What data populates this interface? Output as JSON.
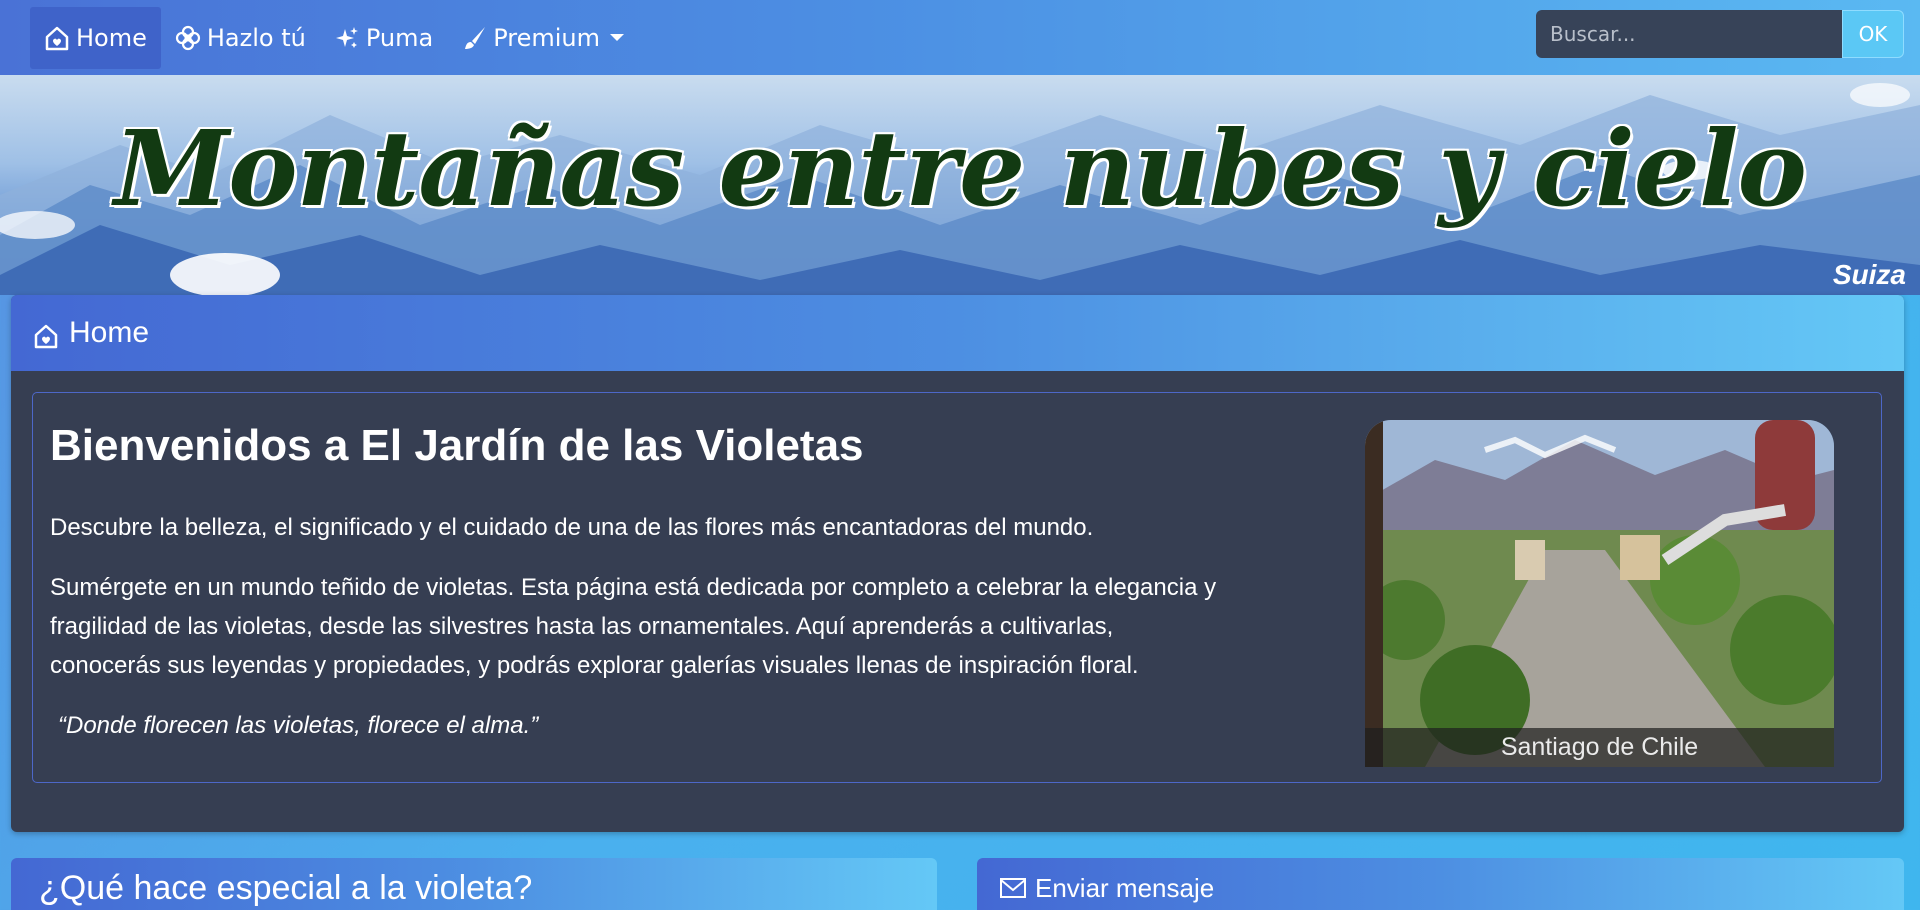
{
  "nav": {
    "items": [
      {
        "label": "Home",
        "icon": "house-heart-icon",
        "active": true
      },
      {
        "label": "Hazlo tú",
        "icon": "flower-icon",
        "active": false
      },
      {
        "label": "Puma",
        "icon": "sparkles-icon",
        "active": false
      },
      {
        "label": "Premium",
        "icon": "brush-icon",
        "active": false,
        "dropdown": true
      }
    ],
    "search": {
      "placeholder": "Buscar...",
      "button_label": "OK"
    }
  },
  "banner": {
    "title": "Montañas entre nubes y cielo",
    "caption": "Suiza"
  },
  "home_panel": {
    "header_label": "Home",
    "header_icon": "house-heart-icon",
    "title": "Bienvenidos a El Jardín de las Violetas",
    "intro": "Descubre la belleza, el significado y el cuidado de una de las flores más encantadoras del mundo.",
    "body_line1": "Sumérgete en un mundo teñido de violetas. Esta página está dedicada por completo a celebrar la elegancia y",
    "body_line2": "fragilidad de las violetas, desde las silvestres hasta las ornamentales. Aquí aprenderás a cultivarlas,",
    "body_line3": "conocerás sus leyendas y propiedades, y podrás explorar galerías visuales llenas de inspiración floral.",
    "quote": "“Donde florecen las violetas, florece el alma.”",
    "photo_caption": "Santiago de Chile"
  },
  "cards": {
    "left_title": "¿Qué hace especial a la violeta?",
    "right_title": "Enviar mensaje",
    "right_icon": "envelope-icon"
  },
  "colors": {
    "navbar_start": "#4a72d6",
    "navbar_end": "#5ab9f2",
    "panel_bg": "#363e52",
    "banner_title": "#123a12",
    "search_button": "#5bc8f5"
  }
}
